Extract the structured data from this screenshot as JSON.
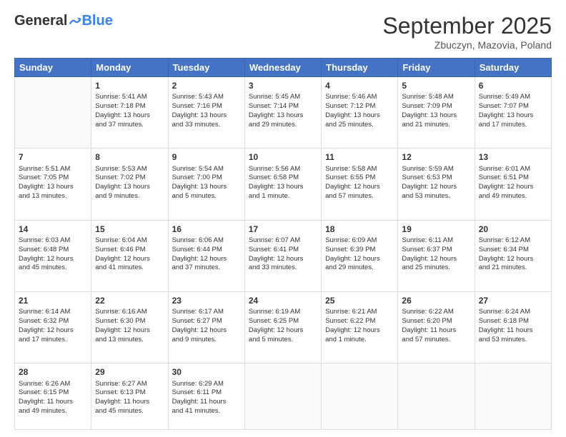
{
  "header": {
    "logo_general": "General",
    "logo_blue": "Blue",
    "month": "September 2025",
    "location": "Zbuczyn, Mazovia, Poland"
  },
  "days_of_week": [
    "Sunday",
    "Monday",
    "Tuesday",
    "Wednesday",
    "Thursday",
    "Friday",
    "Saturday"
  ],
  "weeks": [
    [
      {
        "day": "",
        "info": ""
      },
      {
        "day": "1",
        "info": "Sunrise: 5:41 AM\nSunset: 7:18 PM\nDaylight: 13 hours\nand 37 minutes."
      },
      {
        "day": "2",
        "info": "Sunrise: 5:43 AM\nSunset: 7:16 PM\nDaylight: 13 hours\nand 33 minutes."
      },
      {
        "day": "3",
        "info": "Sunrise: 5:45 AM\nSunset: 7:14 PM\nDaylight: 13 hours\nand 29 minutes."
      },
      {
        "day": "4",
        "info": "Sunrise: 5:46 AM\nSunset: 7:12 PM\nDaylight: 13 hours\nand 25 minutes."
      },
      {
        "day": "5",
        "info": "Sunrise: 5:48 AM\nSunset: 7:09 PM\nDaylight: 13 hours\nand 21 minutes."
      },
      {
        "day": "6",
        "info": "Sunrise: 5:49 AM\nSunset: 7:07 PM\nDaylight: 13 hours\nand 17 minutes."
      }
    ],
    [
      {
        "day": "7",
        "info": "Sunrise: 5:51 AM\nSunset: 7:05 PM\nDaylight: 13 hours\nand 13 minutes."
      },
      {
        "day": "8",
        "info": "Sunrise: 5:53 AM\nSunset: 7:02 PM\nDaylight: 13 hours\nand 9 minutes."
      },
      {
        "day": "9",
        "info": "Sunrise: 5:54 AM\nSunset: 7:00 PM\nDaylight: 13 hours\nand 5 minutes."
      },
      {
        "day": "10",
        "info": "Sunrise: 5:56 AM\nSunset: 6:58 PM\nDaylight: 13 hours\nand 1 minute."
      },
      {
        "day": "11",
        "info": "Sunrise: 5:58 AM\nSunset: 6:55 PM\nDaylight: 12 hours\nand 57 minutes."
      },
      {
        "day": "12",
        "info": "Sunrise: 5:59 AM\nSunset: 6:53 PM\nDaylight: 12 hours\nand 53 minutes."
      },
      {
        "day": "13",
        "info": "Sunrise: 6:01 AM\nSunset: 6:51 PM\nDaylight: 12 hours\nand 49 minutes."
      }
    ],
    [
      {
        "day": "14",
        "info": "Sunrise: 6:03 AM\nSunset: 6:48 PM\nDaylight: 12 hours\nand 45 minutes."
      },
      {
        "day": "15",
        "info": "Sunrise: 6:04 AM\nSunset: 6:46 PM\nDaylight: 12 hours\nand 41 minutes."
      },
      {
        "day": "16",
        "info": "Sunrise: 6:06 AM\nSunset: 6:44 PM\nDaylight: 12 hours\nand 37 minutes."
      },
      {
        "day": "17",
        "info": "Sunrise: 6:07 AM\nSunset: 6:41 PM\nDaylight: 12 hours\nand 33 minutes."
      },
      {
        "day": "18",
        "info": "Sunrise: 6:09 AM\nSunset: 6:39 PM\nDaylight: 12 hours\nand 29 minutes."
      },
      {
        "day": "19",
        "info": "Sunrise: 6:11 AM\nSunset: 6:37 PM\nDaylight: 12 hours\nand 25 minutes."
      },
      {
        "day": "20",
        "info": "Sunrise: 6:12 AM\nSunset: 6:34 PM\nDaylight: 12 hours\nand 21 minutes."
      }
    ],
    [
      {
        "day": "21",
        "info": "Sunrise: 6:14 AM\nSunset: 6:32 PM\nDaylight: 12 hours\nand 17 minutes."
      },
      {
        "day": "22",
        "info": "Sunrise: 6:16 AM\nSunset: 6:30 PM\nDaylight: 12 hours\nand 13 minutes."
      },
      {
        "day": "23",
        "info": "Sunrise: 6:17 AM\nSunset: 6:27 PM\nDaylight: 12 hours\nand 9 minutes."
      },
      {
        "day": "24",
        "info": "Sunrise: 6:19 AM\nSunset: 6:25 PM\nDaylight: 12 hours\nand 5 minutes."
      },
      {
        "day": "25",
        "info": "Sunrise: 6:21 AM\nSunset: 6:22 PM\nDaylight: 12 hours\nand 1 minute."
      },
      {
        "day": "26",
        "info": "Sunrise: 6:22 AM\nSunset: 6:20 PM\nDaylight: 11 hours\nand 57 minutes."
      },
      {
        "day": "27",
        "info": "Sunrise: 6:24 AM\nSunset: 6:18 PM\nDaylight: 11 hours\nand 53 minutes."
      }
    ],
    [
      {
        "day": "28",
        "info": "Sunrise: 6:26 AM\nSunset: 6:15 PM\nDaylight: 11 hours\nand 49 minutes."
      },
      {
        "day": "29",
        "info": "Sunrise: 6:27 AM\nSunset: 6:13 PM\nDaylight: 11 hours\nand 45 minutes."
      },
      {
        "day": "30",
        "info": "Sunrise: 6:29 AM\nSunset: 6:11 PM\nDaylight: 11 hours\nand 41 minutes."
      },
      {
        "day": "",
        "info": ""
      },
      {
        "day": "",
        "info": ""
      },
      {
        "day": "",
        "info": ""
      },
      {
        "day": "",
        "info": ""
      }
    ]
  ]
}
